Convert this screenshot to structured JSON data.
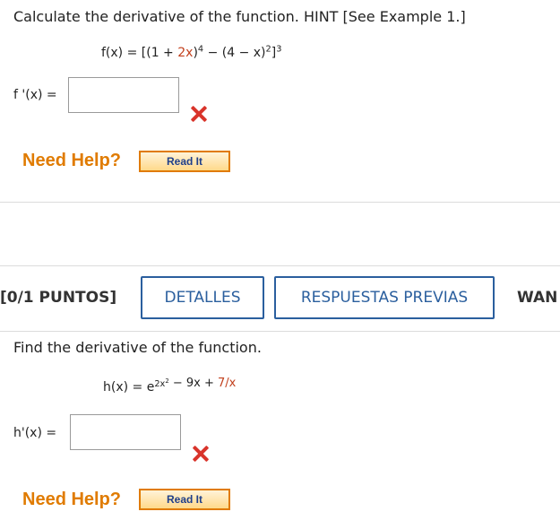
{
  "question1": {
    "prompt": "Calculate the derivative of the function. HINT [See Example 1.]",
    "function": {
      "lhs": "f(x) = [(1 + ",
      "red_term": "2x",
      "paren_close": ")",
      "exp1": "4",
      "minus": " − (4 − x)",
      "exp2": "2",
      "bracket_close": "]",
      "exp3": "3"
    },
    "answer_label": "f '(x) =",
    "answer_value": "",
    "status": "incorrect",
    "need_help": "Need Help?",
    "read_it": "Read It"
  },
  "question2": {
    "points": "[0/1 PUNTOS]",
    "buttons": {
      "details": "DETALLES",
      "previous": "RESPUESTAS PREVIAS",
      "partial": "WAN"
    },
    "prompt": "Find the derivative of the function.",
    "function": {
      "lhs": "h(x) = e",
      "exp_base": "2x",
      "exp_power": "2",
      "rest_black": " − 9x + ",
      "rest_red": "7/x"
    },
    "answer_label": "h'(x) =",
    "answer_value": "",
    "status": "incorrect",
    "need_help": "Need Help?",
    "read_it": "Read It"
  },
  "colors": {
    "accent_blue": "#2b5f9e",
    "help_orange": "#e07b00",
    "error_red": "#d9342b",
    "math_red": "#c2401d"
  },
  "icons": {
    "status": "x-mark-icon"
  }
}
